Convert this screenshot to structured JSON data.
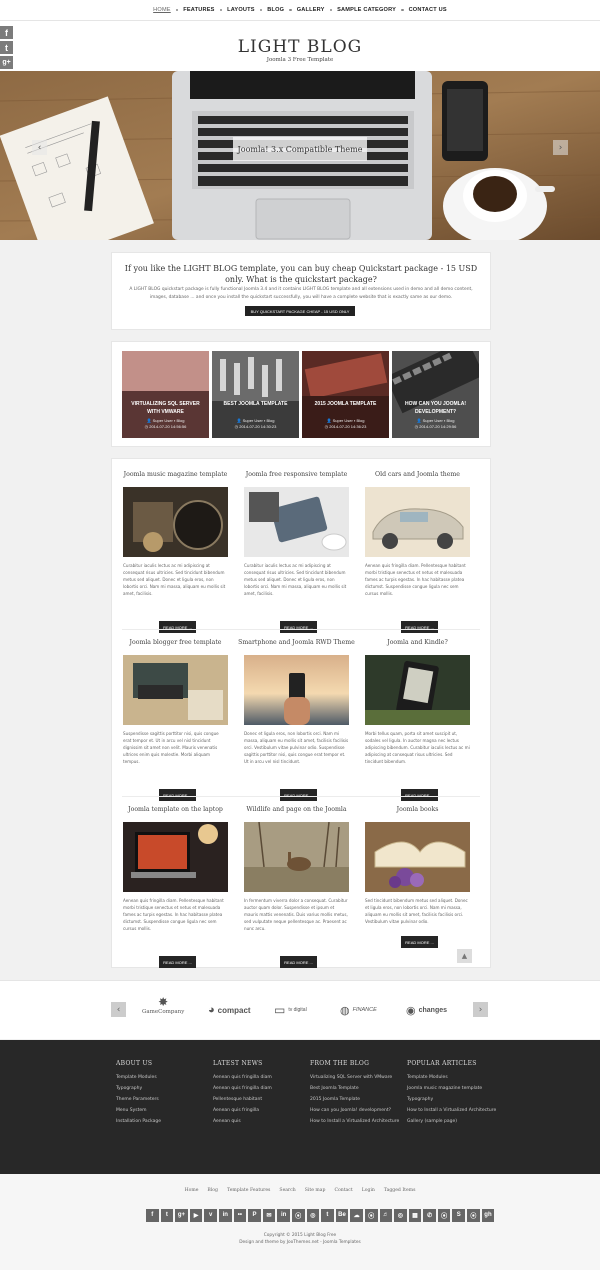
{
  "nav": {
    "items": [
      "HOME",
      "FEATURES",
      "LAYOUTS",
      "BLOG",
      "GALLERY",
      "SAMPLE CATEGORY",
      "CONTACT US"
    ]
  },
  "side_social": [
    "f",
    "t",
    "g+"
  ],
  "header": {
    "title": "LIGHT BLOG",
    "tagline": "Joomla 3 Free Template"
  },
  "hero": {
    "caption": "Joomla! 3.x Compatible Theme",
    "prev_icon": "chevron-left-icon",
    "next_icon": "chevron-right-icon"
  },
  "promo": {
    "title": "If you like the LIGHT BLOG template, you can buy cheap Quickstart package - 15 USD only. What is the quickstart package?",
    "text": "A LIGHT BLOG quickstart package is fully functional Joomla 3.4 and it contains LIGHT BLOG template and all extensions used in demo and all demo content, images, database ... and once you install the quickstart successfully, you will have a complete website that is exactly same as our demo.",
    "button": "BUY QUICKSTART PACKAGE CHEAP - 15 USD ONLY"
  },
  "featured": [
    {
      "title": "VIRTUALIZING SQL SERVER WITH VMWARE",
      "author": "Super User",
      "category": "Blog",
      "date": "2014-07-20 14:56:56"
    },
    {
      "title": "BEST JOOMLA TEMPLATE",
      "author": "Super User",
      "category": "Blog",
      "date": "2014-07-20 14:30:23"
    },
    {
      "title": "2015 JOOMLA TEMPLATE",
      "author": "Super User",
      "category": "Blog",
      "date": "2014-07-20 14:36:23"
    },
    {
      "title": "HOW CAN YOU JOOMLA! DEVELOPMENT?",
      "author": "Super User",
      "category": "Blog",
      "date": "2014-07-20 14:29:56"
    }
  ],
  "articles": [
    {
      "title": "Joomla music magazine template",
      "text": "Curabitur iaculis lectus ac mi adipiscing at consequat risus ultricies. Sed tincidunt bibendum metus sed aliquet. Donec et ligula eros, non lobortis orci. Nam mi massa, aliquam eu mollis sit amet, facilisis.",
      "button": "READ MORE ..."
    },
    {
      "title": "Joomla free responsive template",
      "text": "Curabitur iaculis lectus ac mi adipiscing at consequat risus ultricies. Sed tincidunt bibendum metus sed aliquet. Donec et ligula eros, non lobortis orci. Nam mi massa, aliquam eu mollis sit amet, facilisis.",
      "button": "READ MORE ..."
    },
    {
      "title": "Old cars and Joomla theme",
      "text": "Aenean quis fringilla diam. Pellentesque habitant morbi tristique senectus et netus et malesuada fames ac turpis egestas. In hac habitasse platea dictumst. Suspendisse congue ligula nec sem cursus mollis.",
      "button": "READ MORE ..."
    },
    {
      "title": "Joomla blogger free template",
      "text": "Suspendisse sagittis porttitor nisi, quis congue erat tempor et. Ut in arcu vel nisl tincidunt dignissim sit amet non velit. Mauris venenatis ultrices enim quis molestie. Morbi aliquam tempus.",
      "button": "READ MORE ..."
    },
    {
      "title": "Smartphone and Joomla RWD Theme",
      "text": "Donec et ligula eros, non lobortis orci. Nam mi massa, aliquam eu mollis sit amet, facilisis facilisis orci. Vestibulum vitae pulvinar odio. Suspendisse sagittis porttitor nisi, quis congue erat tempor et. Ut in arcu vel nisl tincidunt.",
      "button": "READ MORE ..."
    },
    {
      "title": "Joomla and Kindle?",
      "text": "Morbi tellus quam, porta sit amet suscipit ut, sodales vel ligula. In auctor magna nec lectus adipiscing bibendum. Curabitur iaculis lectus ac mi adipiscing at consequat risus ultricies. Sed tincidunt bibendum.",
      "button": "READ MORE ..."
    },
    {
      "title": "Joomla template on the laptop",
      "text": "Aenean quis fringilla diam. Pellentesque habitant morbi tristique senectus et netus et malesuada fames ac turpis egestas. In hac habitasse platea dictumst. Suspendisse congue ligula nec sem cursus mollis.",
      "button": "READ MORE ..."
    },
    {
      "title": "Wildlife and page on the Joomla",
      "text": "In fermentum viverra dolor a consequat. Curabitur auctor quam dolor. Suspendisse et ipsum et mauris mattis venenatis. Duis varius mollis metus, sed vulputate neque pellentesque ac. Praesent ac nunc arcu.",
      "button": "READ MORE ..."
    },
    {
      "title": "Joomla books",
      "text": "Sed tincidunt bibendum metus sed aliquet. Donec et ligula eros, non lobortis orci. Nam mi massa, aliquam eu mollis sit amet, facilisis facilisis orci. Vestibulum vitae pulvinar odio.",
      "button": "READ MORE ..."
    }
  ],
  "clients": [
    {
      "name": "GameCompany",
      "icon": "game-company-logo-icon"
    },
    {
      "name": "compact",
      "icon": "compact-logo-icon"
    },
    {
      "name": "tv digital",
      "icon": "tv-digital-logo-icon"
    },
    {
      "name": "FINANCE",
      "icon": "finance-logo-icon"
    },
    {
      "name": "changes",
      "icon": "changes-logo-icon"
    }
  ],
  "footer": {
    "columns": [
      {
        "title": "ABOUT US",
        "links": [
          "Template Modules",
          "Typography",
          "Theme Parameters",
          "Menu System",
          "Installation Package"
        ]
      },
      {
        "title": "LATEST NEWS",
        "links": [
          "Aenean quis fringilla diam",
          "Aenean quis fringilla diam",
          "Pellentesque habitant",
          "Aenean quis fringilla",
          "Aenean quis"
        ]
      },
      {
        "title": "FROM THE BLOG",
        "links": [
          "Virtualizing SQL Server with VMware",
          "Best Joomla Template",
          "2015 Joomla Template",
          "How can you Joomla! development?",
          "How to Install a Virtualized Architecture"
        ]
      },
      {
        "title": "POPULAR ARTICLES",
        "links": [
          "Template Modules",
          "Joomla music magazine template",
          "Typography",
          "How to Install a Virtualized Architecture",
          "Gallery (sample page)"
        ]
      }
    ]
  },
  "bottom_menu": [
    "Home",
    "Blog",
    "Template Features",
    "Search",
    "Site map",
    "Contact",
    "Login",
    "Tagged Items"
  ],
  "social_icons": [
    "f",
    "t",
    "g+",
    "▶",
    "v",
    "in",
    "••",
    "P",
    "✉",
    "in",
    "⦿",
    "◎",
    "t",
    "Be",
    "☁",
    "⦿",
    "♬",
    "◎",
    "▦",
    "✆",
    "⦿",
    "S",
    "⦿",
    "gh"
  ],
  "copyright": [
    "Copyright © 2015 Light Blog Free",
    "Design and theme by JooThemes.net - Joomla Templates"
  ],
  "colors": {
    "dark": "#222222",
    "footer_bg": "#282828",
    "page_bg": "#f1f1f1"
  }
}
